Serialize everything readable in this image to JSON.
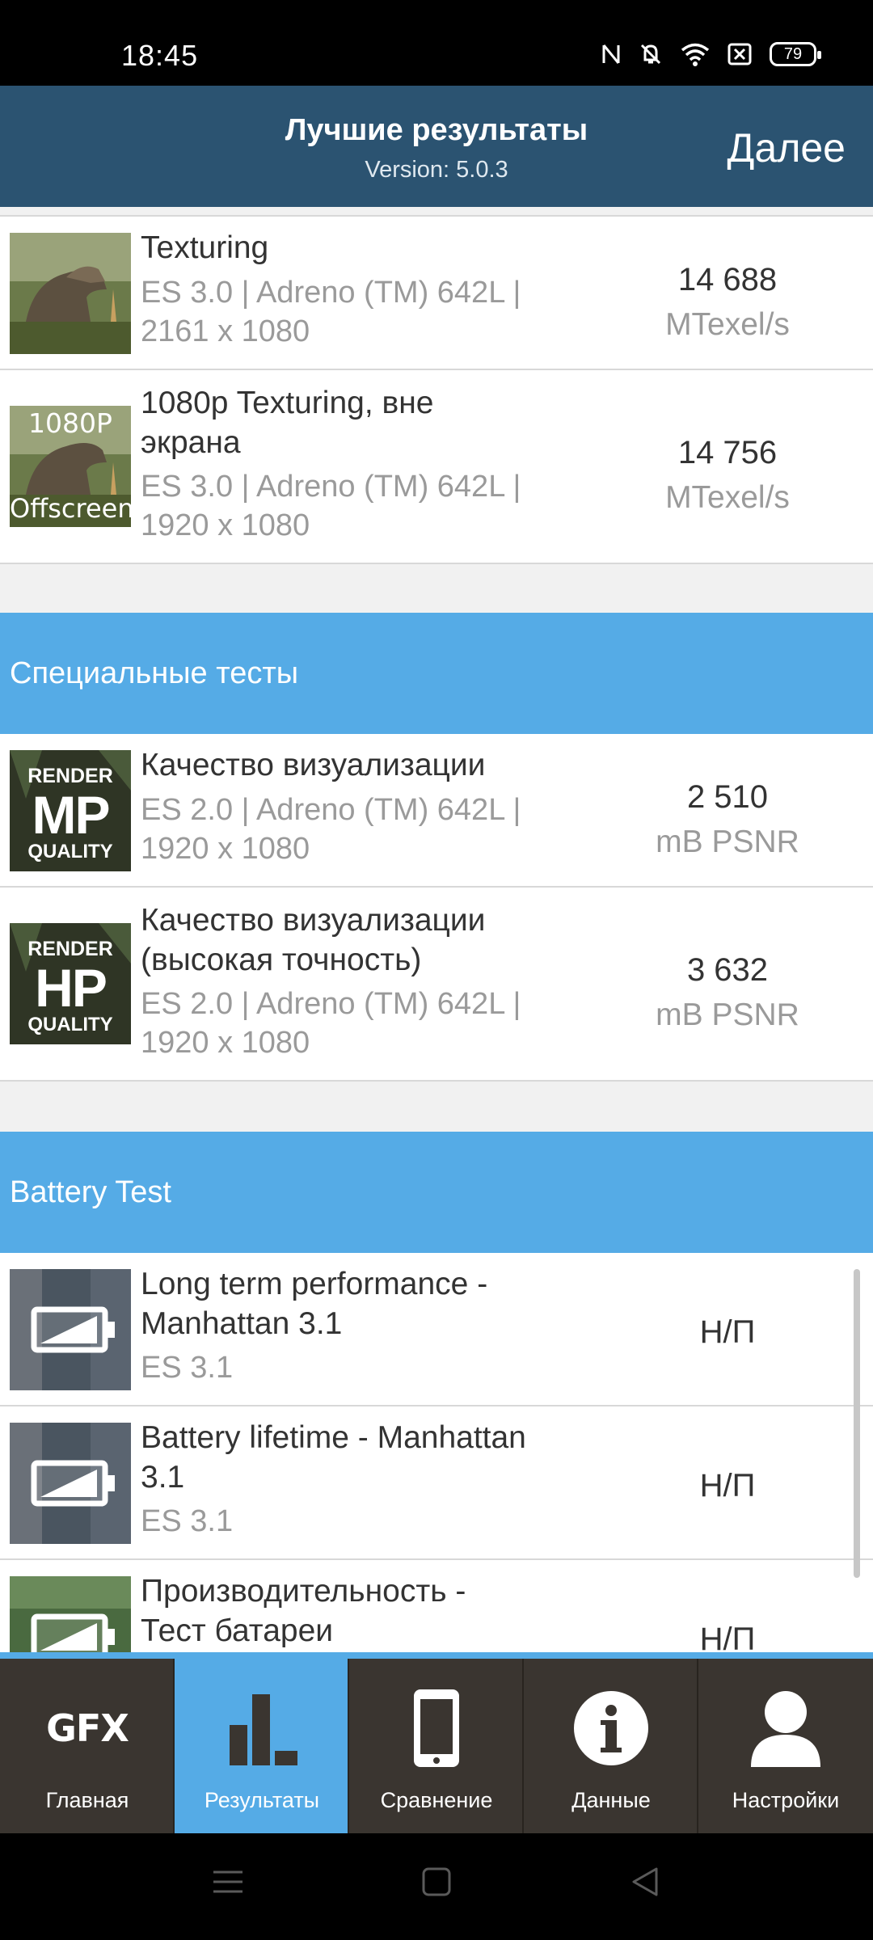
{
  "status_bar": {
    "time": "18:45",
    "battery": "79",
    "icons": [
      "nfc-icon",
      "bell-off-icon",
      "wifi-icon",
      "sim-off-icon",
      "battery-icon"
    ]
  },
  "app_bar": {
    "title": "Лучшие результаты",
    "version": "Version: 5.0.3",
    "next_label": "Далее"
  },
  "results": [
    {
      "thumb_icon": "dinosaur-thumbnail",
      "title": "Texturing",
      "sub1": "ES 3.0 | Adreno (TM) 642L |",
      "sub2": "2161 x 1080",
      "score": "14 688",
      "unit": "MTexel/s"
    },
    {
      "thumb_icon": "dinosaur-offscreen-thumbnail",
      "thumb_top": "1080P",
      "thumb_bottom": "Offscreen",
      "title1": "1080p Texturing, вне",
      "title2": "экрана",
      "sub1": "ES 3.0 | Adreno (TM) 642L |",
      "sub2": "1920 x 1080",
      "score": "14 756",
      "unit": "MTexel/s"
    }
  ],
  "special": {
    "header": "Специальные тесты",
    "items": [
      {
        "thumb_top": "RENDER",
        "thumb_mid": "MP",
        "thumb_bottom": "QUALITY",
        "title": "Качество визуализации",
        "sub1": "ES 2.0 | Adreno (TM) 642L |",
        "sub2": "1920 x 1080",
        "score": "2 510",
        "unit": "mB PSNR"
      },
      {
        "thumb_top": "RENDER",
        "thumb_mid": "HP",
        "thumb_bottom": "QUALITY",
        "title1": "Качество визуализации",
        "title2": "(высокая точность)",
        "sub1": "ES 2.0 | Adreno (TM) 642L |",
        "sub2": "1920 x 1080",
        "score": "3 632",
        "unit": "mB PSNR"
      }
    ]
  },
  "battery": {
    "header": "Battery Test",
    "items": [
      {
        "title1": "Long term performance -",
        "title2": "Manhattan 3.1",
        "sub": "ES 3.1",
        "score": "Н/П"
      },
      {
        "title1": "Battery lifetime - Manhattan",
        "title2": "3.1",
        "sub": "ES 3.1",
        "score": "Н/П"
      },
      {
        "title1": "Производительность -",
        "title2": "Тест батареи",
        "score": "Н/П"
      }
    ]
  },
  "bottom_nav": {
    "items": [
      {
        "label": "Главная",
        "icon_text": "GFX"
      },
      {
        "label": "Результаты"
      },
      {
        "label": "Сравнение"
      },
      {
        "label": "Данные"
      },
      {
        "label": "Настройки"
      }
    ]
  },
  "colors": {
    "app_bar": "#2b5371",
    "accent": "#55abe6",
    "nav_bg": "#3a3530"
  }
}
